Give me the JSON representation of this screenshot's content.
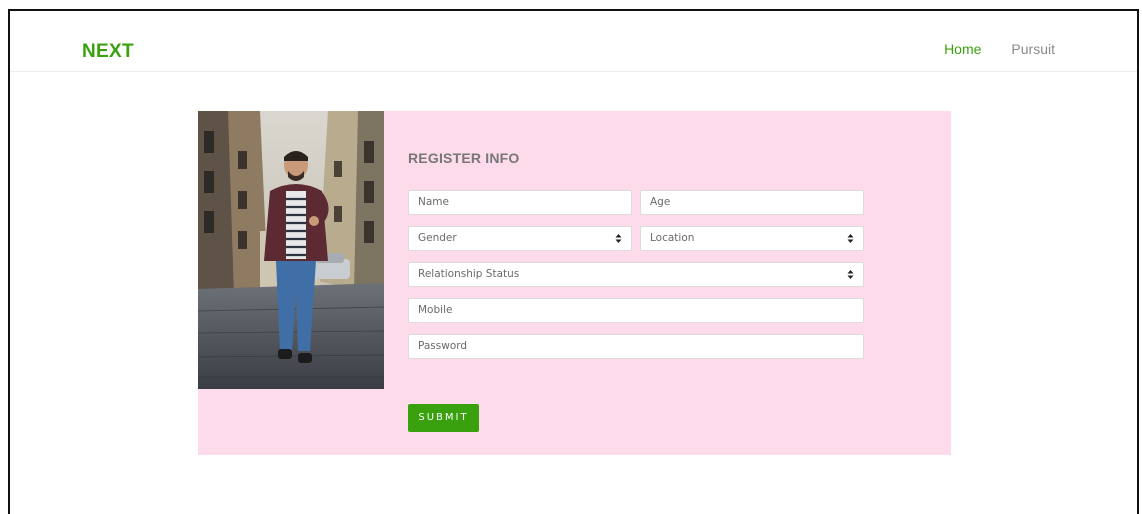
{
  "navbar": {
    "brand": "NEXT",
    "links": [
      {
        "label": "Home",
        "active": true
      },
      {
        "label": "Pursuit",
        "active": false
      }
    ]
  },
  "form": {
    "title": "REGISTER INFO",
    "fields": {
      "name": {
        "placeholder": "Name"
      },
      "age": {
        "placeholder": "Age"
      },
      "gender": {
        "placeholder": "Gender"
      },
      "location": {
        "placeholder": "Location"
      },
      "relationship_status": {
        "placeholder": "Relationship Status"
      },
      "mobile": {
        "placeholder": "Mobile"
      },
      "password": {
        "placeholder": "Password"
      }
    },
    "submit_label": "SUBMIT"
  },
  "colors": {
    "accent": "#3aa10e",
    "card_background": "#fddbea",
    "muted_text": "#8a8a8a"
  },
  "icons": {
    "select_arrow": "up-down-chevron-icon"
  }
}
